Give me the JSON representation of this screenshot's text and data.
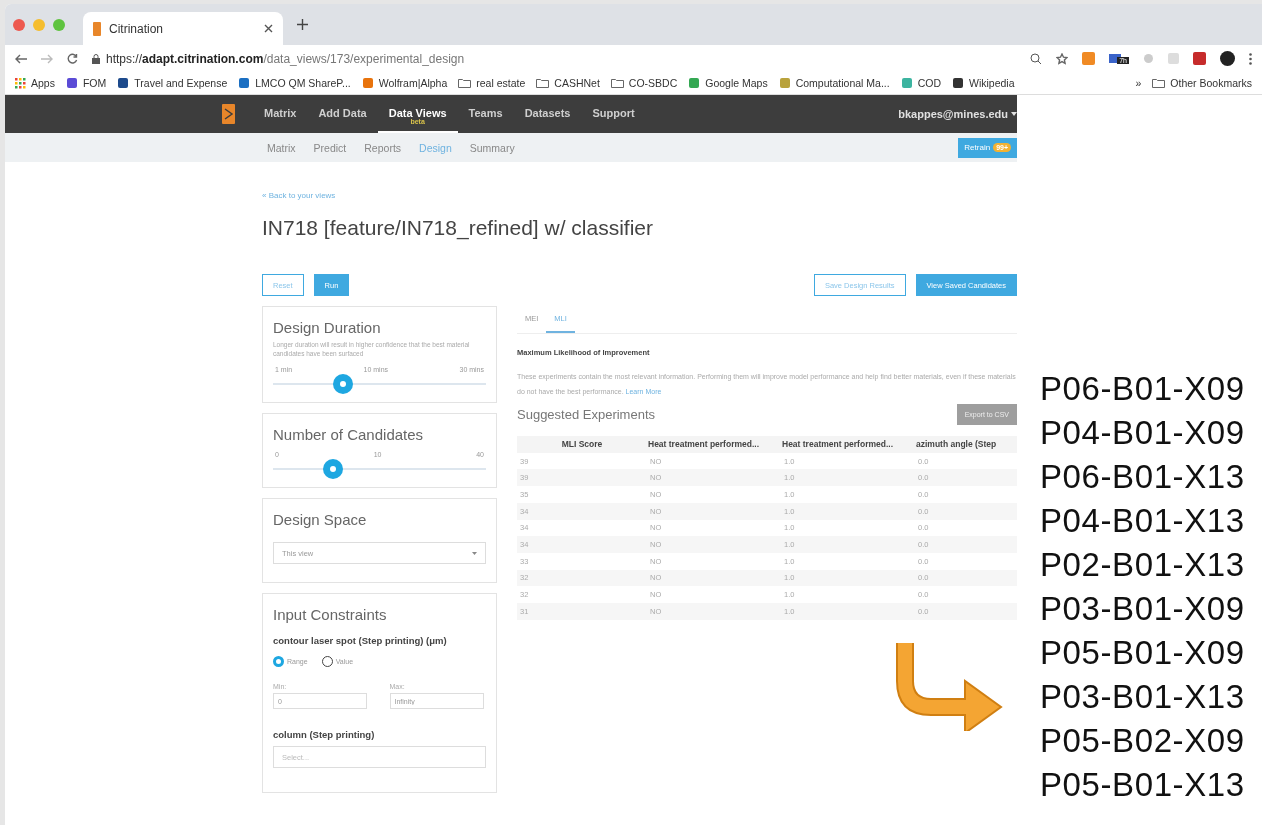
{
  "browser": {
    "tab_title": "Citrination",
    "url": {
      "scheme": "https://",
      "host": "adapt.citrination.com",
      "path": "/data_views/173/experimental_design"
    },
    "extension_badge": "7h",
    "bookmarks": [
      {
        "label": "Apps",
        "kind": "apps"
      },
      {
        "label": "FOM",
        "kind": "site",
        "color": "#5b4bd6"
      },
      {
        "label": "Travel and Expense",
        "kind": "site",
        "color": "#1d4a8c"
      },
      {
        "label": "LMCO QM ShareP...",
        "kind": "site",
        "color": "#1b6fc2"
      },
      {
        "label": "Wolfram|Alpha",
        "kind": "site",
        "color": "#e8730c"
      },
      {
        "label": "real estate",
        "kind": "folder"
      },
      {
        "label": "CASHNet",
        "kind": "folder"
      },
      {
        "label": "CO-SBDC",
        "kind": "folder"
      },
      {
        "label": "Google Maps",
        "kind": "site",
        "color": "#34a853"
      },
      {
        "label": "Computational Ma...",
        "kind": "site",
        "color": "#b9a23c"
      },
      {
        "label": "COD",
        "kind": "site",
        "color": "#3cb4a0"
      },
      {
        "label": "Wikipedia",
        "kind": "site",
        "color": "#333333"
      }
    ],
    "more": "»",
    "other_bookmarks": "Other Bookmarks"
  },
  "nav": {
    "items": [
      {
        "label": "Matrix",
        "selected": false
      },
      {
        "label": "Add Data",
        "selected": false
      },
      {
        "label": "Data Views",
        "selected": true,
        "badge": "beta"
      },
      {
        "label": "Teams",
        "selected": false
      },
      {
        "label": "Datasets",
        "selected": false
      },
      {
        "label": "Support",
        "selected": false
      }
    ],
    "user": "bkappes@mines.edu"
  },
  "subnav": {
    "items": [
      {
        "label": "Matrix",
        "selected": false
      },
      {
        "label": "Predict",
        "selected": false
      },
      {
        "label": "Reports",
        "selected": false
      },
      {
        "label": "Design",
        "selected": true
      },
      {
        "label": "Summary",
        "selected": false
      }
    ],
    "retrain": {
      "label": "Retrain",
      "badge": "99+"
    }
  },
  "page": {
    "back_link": "« Back to your views",
    "title": "IN718 [feature/IN718_refined] w/ classifier",
    "reset": "Reset",
    "run": "Run",
    "save": "Save Design Results",
    "view_saved": "View Saved Candidates"
  },
  "duration": {
    "title": "Design Duration",
    "description": "Longer duration will result in higher confidence that the best material candidates have been surfaced",
    "labels": [
      "1 min",
      "10 mins",
      "30 mins"
    ],
    "level": 0.33
  },
  "candidates": {
    "title": "Number of Candidates",
    "labels": [
      "0",
      "10",
      "40"
    ],
    "level": 0.28
  },
  "design_space": {
    "title": "Design Space",
    "value": "This view"
  },
  "constraints": {
    "title": "Input Constraints",
    "field": "contour laser spot (Step printing) (μm)",
    "options": [
      {
        "label": "Range",
        "selected": true
      },
      {
        "label": "Value",
        "selected": false
      }
    ],
    "min_label": "Min:",
    "min_value": "0",
    "max_label": "Max:",
    "max_value": "Infinity",
    "field2": "column (Step printing)",
    "field2_placeholder": "Select..."
  },
  "result_tabs": [
    {
      "label": "MEI",
      "selected": false
    },
    {
      "label": "MLI",
      "selected": true
    }
  ],
  "results": {
    "heading": "Maximum Likelihood of Improvement",
    "description": "These experiments contain the most relevant information. Performing them will improve model performance and help find better materials, even if these materials do not have the best performance.",
    "learn_more": "Learn More",
    "suggested": "Suggested Experiments",
    "export": "Export to CSV"
  },
  "table": {
    "columns": [
      "MLI Score",
      "Heat treatment performed...",
      "Heat treatment performed...",
      "azimuth angle (Step"
    ],
    "rows": [
      [
        "39",
        "NO",
        "1.0",
        "0.0"
      ],
      [
        "39",
        "NO",
        "1.0",
        "0.0"
      ],
      [
        "35",
        "NO",
        "1.0",
        "0.0"
      ],
      [
        "34",
        "NO",
        "1.0",
        "0.0"
      ],
      [
        "34",
        "NO",
        "1.0",
        "0.0"
      ],
      [
        "34",
        "NO",
        "1.0",
        "0.0"
      ],
      [
        "33",
        "NO",
        "1.0",
        "0.0"
      ],
      [
        "32",
        "NO",
        "1.0",
        "0.0"
      ],
      [
        "32",
        "NO",
        "1.0",
        "0.0"
      ],
      [
        "31",
        "NO",
        "1.0",
        "0.0"
      ]
    ]
  },
  "annotation": {
    "ids": [
      "P06-B01-X09",
      "P04-B01-X09",
      "P06-B01-X13",
      "P04-B01-X13",
      "P02-B01-X13",
      "P03-B01-X09",
      "P05-B01-X09",
      "P03-B01-X13",
      "P05-B02-X09",
      "P05-B01-X13"
    ]
  }
}
